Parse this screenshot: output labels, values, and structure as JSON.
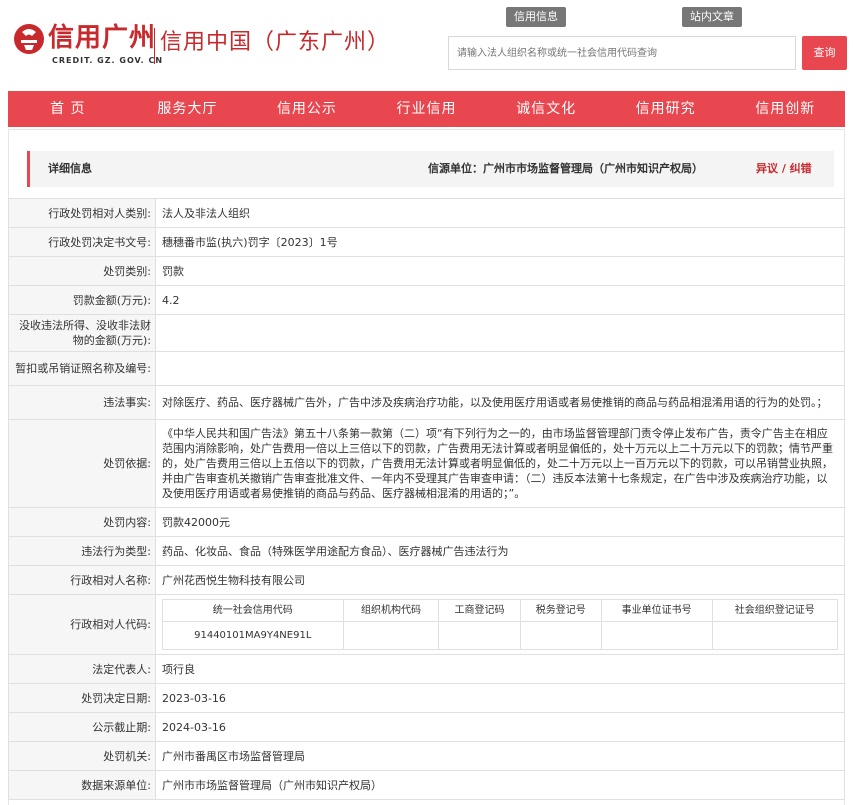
{
  "header": {
    "logo_text": "信用广州",
    "logo_sub": "CREDIT. GZ. GOV. CN",
    "region_title": "信用中国（广东广州）",
    "search_tabs": [
      "信用信息",
      "站内文章"
    ],
    "search_placeholder": "请输入法人组织名称或统一社会信用代码查询",
    "search_button": "查询"
  },
  "nav": {
    "items": [
      "首    页",
      "服务大厅",
      "信用公示",
      "行业信用",
      "诚信文化",
      "信用研究",
      "信用创新"
    ]
  },
  "detail": {
    "title": "详细信息",
    "source": "信源单位：广州市市场监督管理局（广州市知识产权局）",
    "objection": "异议 / 纠错"
  },
  "rows": [
    {
      "label": "行政处罚相对人类别:",
      "value": "法人及非法人组织"
    },
    {
      "label": "行政处罚决定书文号:",
      "value": "穗穗番市监(执六)罚字〔2023〕1号"
    },
    {
      "label": "处罚类别:",
      "value": "罚款"
    },
    {
      "label": "罚款金额(万元):",
      "value": "4.2"
    },
    {
      "label": "没收违法所得、没收非法财物的金额(万元):",
      "value": ""
    },
    {
      "label": "暂扣或吊销证照名称及编号:",
      "value": ""
    },
    {
      "label": "违法事实:",
      "value": "对除医疗、药品、医疗器械广告外，广告中涉及疾病治疗功能，以及使用医疗用语或者易使推销的商品与药品相混淆用语的行为的处罚。；"
    },
    {
      "label": "处罚依据:",
      "value": "《中华人民共和国广告法》第五十八条第一款第（二）项“有下列行为之一的，由市场监督管理部门责令停止发布广告，责令广告主在相应范围内消除影响，处广告费用一倍以上三倍以下的罚款，广告费用无法计算或者明显偏低的，处十万元以上二十万元以下的罚款；情节严重的，处广告费用三倍以上五倍以下的罚款，广告费用无法计算或者明显偏低的，处二十万元以上一百万元以下的罚款，可以吊销营业执照，并由广告审查机关撤销广告审查批准文件、一年内不受理其广告审查申请：（二）违反本法第十七条规定，在广告中涉及疾病治疗功能，以及使用医疗用语或者易使推销的商品与药品、医疗器械相混淆的用语的；”。"
    },
    {
      "label": "处罚内容:",
      "value": "罚款42000元"
    },
    {
      "label": "违法行为类型:",
      "value": "药品、化妆品、食品（特殊医学用途配方食品）、医疗器械广告违法行为"
    },
    {
      "label": "行政相对人名称:",
      "value": "广州花西悦生物科技有限公司"
    }
  ],
  "codes": {
    "label": "行政相对人代码:",
    "headers": [
      "统一社会信用代码",
      "组织机构代码",
      "工商登记码",
      "税务登记号",
      "事业单位证书号",
      "社会组织登记证号"
    ],
    "values": [
      "91440101MA9Y4NE91L",
      "",
      "",
      "",
      "",
      ""
    ]
  },
  "rows_after": [
    {
      "label": "法定代表人:",
      "value": "项行良"
    },
    {
      "label": "处罚决定日期:",
      "value": "2023-03-16"
    },
    {
      "label": "公示截止期:",
      "value": "2024-03-16"
    },
    {
      "label": "处罚机关:",
      "value": "广州市番禺区市场监督管理局"
    },
    {
      "label": "数据来源单位:",
      "value": "广州市市场监督管理局（广州市知识产权局）"
    }
  ],
  "colors": {
    "brand_red": "#c7292c",
    "nav_red": "#e8474f"
  }
}
